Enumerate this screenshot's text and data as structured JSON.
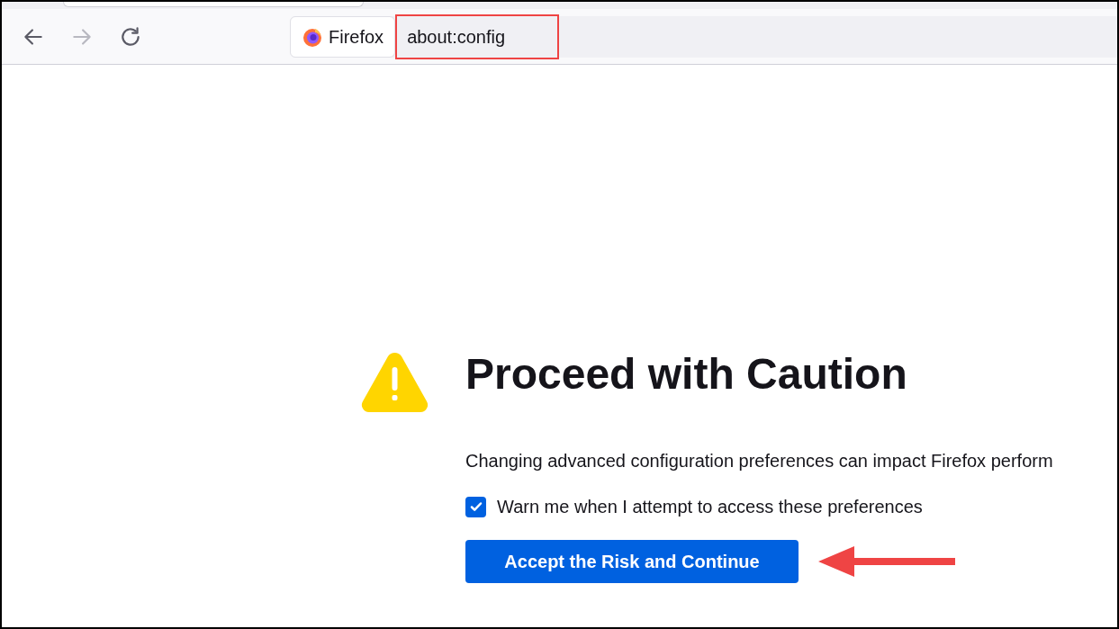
{
  "toolbar": {
    "identity_label": "Firefox",
    "address": "about:config",
    "address_highlighted": true,
    "forward_disabled": true
  },
  "content": {
    "title": "Proceed with Caution",
    "description": "Changing advanced configuration preferences can impact Firefox perform",
    "warn_checkbox": {
      "label": "Warn me when I attempt to access these preferences",
      "checked": true
    },
    "accept_button": "Accept the Risk and Continue",
    "pointer_arrow": true
  }
}
